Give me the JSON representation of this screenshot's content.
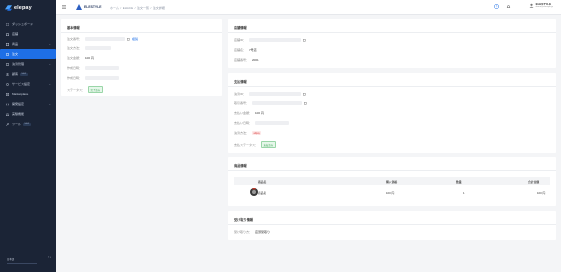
{
  "brand": {
    "name": "elepay"
  },
  "sidebar": {
    "items": [
      {
        "label": "ダッシュボード",
        "icon": "dashboard-icon",
        "chevron": false
      },
      {
        "label": "店舗",
        "icon": "store-icon",
        "chevron": false
      },
      {
        "label": "商品",
        "icon": "product-icon",
        "chevron": true
      },
      {
        "label": "注文",
        "icon": "order-icon",
        "chevron": false,
        "active": true
      },
      {
        "label": "決済管理",
        "icon": "payment-icon",
        "chevron": true
      },
      {
        "label": "顧客",
        "icon": "customer-icon",
        "chevron": false,
        "badge": "NEW"
      },
      {
        "label": "サービス設定",
        "icon": "settings-icon",
        "chevron": true
      },
      {
        "label": "Marketplace",
        "icon": "marketplace-icon",
        "chevron": false
      },
      {
        "label": "開発設定",
        "icon": "developer-icon",
        "chevron": true
      },
      {
        "label": "実験機能",
        "icon": "experiment-icon",
        "chevron": false
      },
      {
        "label": "ツール",
        "icon": "tool-icon",
        "chevron": false,
        "badge": "NEW"
      }
    ],
    "footer": {
      "label": "日本語",
      "arrows": "↑↓"
    }
  },
  "header": {
    "shop_name": "ELESTYLE",
    "breadcrumbs": [
      "ホーム",
      "/",
      "EHACE",
      "/",
      "注文一覧",
      "/",
      "注文詳細"
    ],
    "user": {
      "name": "ELESTYLE",
      "email": "demo@elestyle.jp"
    }
  },
  "basic_info": {
    "title": "基本情報",
    "fields": [
      {
        "label": "注文番号：",
        "value": "",
        "action": "複製"
      },
      {
        "label": "注文方法：",
        "value": ""
      },
      {
        "label": "注文金額：",
        "value": "100 円"
      },
      {
        "label": "作成日時：",
        "value": ""
      },
      {
        "label": "作成日時：",
        "value": ""
      },
      {
        "label": "ステータス：",
        "status": "完了済み"
      }
    ]
  },
  "store_info": {
    "title": "店舗情報",
    "fields": [
      {
        "label": "店舗ID：",
        "value": ""
      },
      {
        "label": "店舗名：",
        "value": "7号店"
      },
      {
        "label": "店舗番号：",
        "value": "2001"
      }
    ]
  },
  "payment_info": {
    "title": "支払情報",
    "fields": [
      {
        "label": "決済ID：",
        "value": ""
      },
      {
        "label": "取引番号：",
        "value": ""
      },
      {
        "label": "支払い金額：",
        "value": "100 円"
      },
      {
        "label": "支払い日時：",
        "value": ""
      },
      {
        "label": "決済方法：",
        "method": "alipay"
      },
      {
        "label": "支払ステータス：",
        "status": "支払済み"
      }
    ]
  },
  "product_info": {
    "title": "商品情報",
    "columns": [
      "商品名",
      "購入価格",
      "数量",
      "合計金額"
    ],
    "rows": [
      {
        "name": "商品名",
        "price": "100 円",
        "qty": "1",
        "total": "100 円"
      }
    ]
  },
  "pickup_info": {
    "title": "受け取り情報",
    "fields": [
      {
        "label": "受け取り方：",
        "value": "店頭受取り"
      }
    ]
  },
  "colors": {
    "accent": "#1e6fe6",
    "sidebar": "#1b2436",
    "success": "#2e9c4a",
    "danger": "#d93b3b"
  }
}
